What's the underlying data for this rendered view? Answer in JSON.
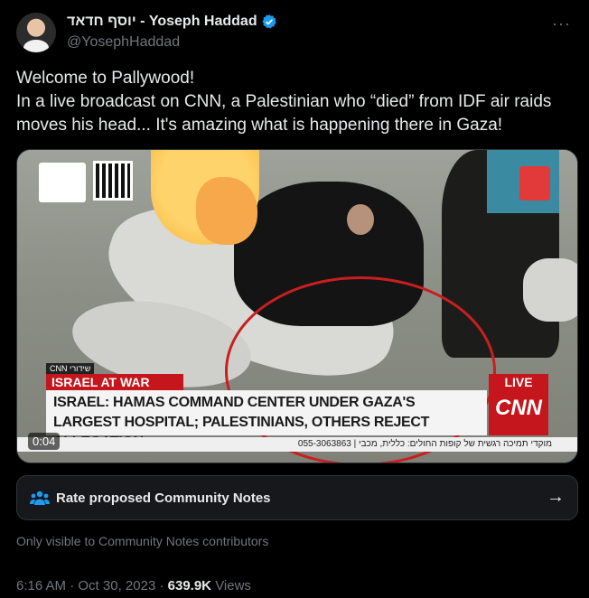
{
  "author": {
    "display_name": "יוסף חדאד - Yoseph Haddad",
    "handle": "@YosephHaddad",
    "verified": true
  },
  "tweet": {
    "text": "Welcome to Pallywood!\nIn a live broadcast on CNN, a Palestinian who “died” from IDF air raids moves his head... It's amazing what is happening there in Gaza!"
  },
  "media": {
    "chyron_tag_small": "CNN שידורי",
    "war_tag": "ISRAEL AT WAR",
    "headline": "ISRAEL: HAMAS COMMAND CENTER UNDER GAZA'S LARGEST HOSPITAL; PALESTINIANS, OTHERS REJECT ALLEGATION",
    "live_label": "LIVE",
    "network": "CNN",
    "ticker": "055-3063863 | מוקדי תמיכה רגשית של קופות החולים: כללית, מכבי",
    "timestamp": "0:04"
  },
  "community_notes": {
    "button_label": "Rate proposed Community Notes",
    "visibility_note": "Only visible to Community Notes contributors"
  },
  "meta": {
    "time": "6:16 AM",
    "date": "Oct 30, 2023",
    "views_count": "639.9K",
    "views_label": "Views"
  },
  "colors": {
    "background": "#000000",
    "verified_blue": "#1d9bf0",
    "secondary_text": "#71767b",
    "cnn_red": "#c4161c"
  }
}
